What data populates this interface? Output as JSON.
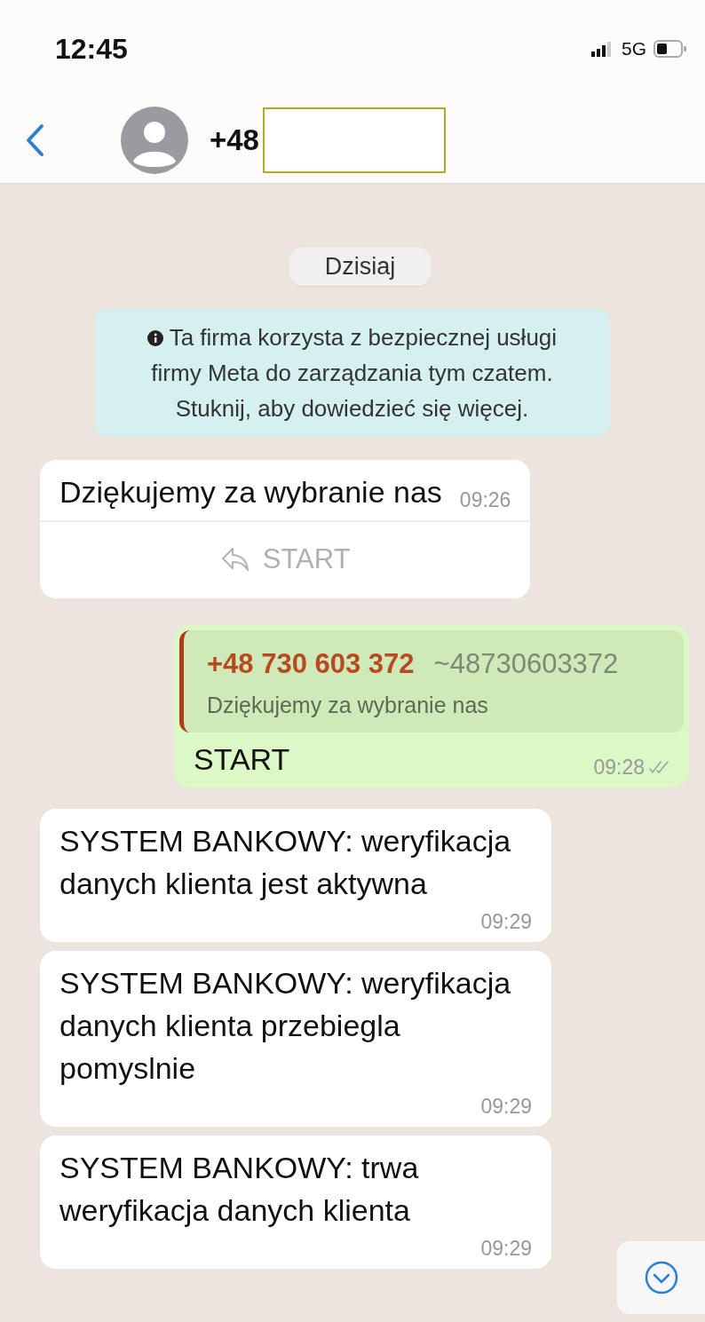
{
  "status_bar": {
    "time": "12:45",
    "network": "5G"
  },
  "header": {
    "title": "+48",
    "redacted": true
  },
  "messages": [
    {
      "kind": "date",
      "text": "Dzisiaj"
    },
    {
      "kind": "info",
      "text": "Ta firma korzysta z bezpiecznej usługi firmy Meta do zarządzania tym czatem. Stuknij, aby dowiedzieć się więcej."
    },
    {
      "kind": "incoming",
      "text": "Dziękujemy za wybranie nas",
      "time": "09:26",
      "button": "START"
    },
    {
      "kind": "outgoing",
      "quote": {
        "author": "+48 730 603 372",
        "handle": "~48730603372",
        "text": "Dziękujemy za wybranie nas"
      },
      "text": "START",
      "time": "09:28",
      "read": false
    },
    {
      "kind": "incoming",
      "text": "SYSTEM BANKOWY: weryfikacja danych klienta jest aktywna",
      "time": "09:29"
    },
    {
      "kind": "incoming",
      "text": "SYSTEM BANKOWY: weryfikacja danych klienta przebiegla pomyslnie",
      "time": "09:29"
    },
    {
      "kind": "incoming",
      "text": "SYSTEM BANKOWY: trwa weryfikacja danych klienta",
      "time": "09:29"
    }
  ]
}
